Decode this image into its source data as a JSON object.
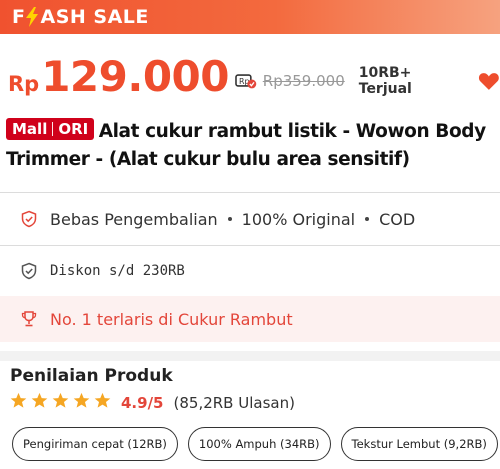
{
  "flash": {
    "label": "FLASH SALE",
    "label_rest": "ASH SALE",
    "label_first": "F"
  },
  "price": {
    "currency": "Rp",
    "current": "129.000",
    "original": "Rp359.000",
    "sold": "10RB+ Terjual"
  },
  "product": {
    "badge_left": "Mall",
    "badge_right": "ORI",
    "title": "Alat cukur rambut listik - Wowon Body Trimmer - (Alat cukur bulu area sensitif)"
  },
  "guarantees": {
    "items": [
      "Bebas Pengembalian",
      "100% Original",
      "COD"
    ]
  },
  "discount": {
    "text": "Diskon s/d 230RB"
  },
  "ranking": {
    "text": "No. 1 terlaris di Cukur Rambut"
  },
  "reviews": {
    "heading": "Penilaian Produk",
    "stars": 5,
    "score": "4.9/5",
    "count": "(85,2RB Ulasan)",
    "chips": [
      "Pengiriman cepat (12RB)",
      "100% Ampuh (34RB)",
      "Tekstur Lembut (9,2RB)"
    ]
  },
  "colors": {
    "accent": "#ee4d2d",
    "mall_badge": "#d0011b",
    "rank_text": "#e3463a",
    "star": "#f5a623"
  },
  "icons": {
    "bolt": "lightning-bolt-icon",
    "price_tag": "price-tag-icon",
    "heart": "heart-icon",
    "shield": "shield-check-icon",
    "trophy": "trophy-icon",
    "star": "star-icon"
  }
}
